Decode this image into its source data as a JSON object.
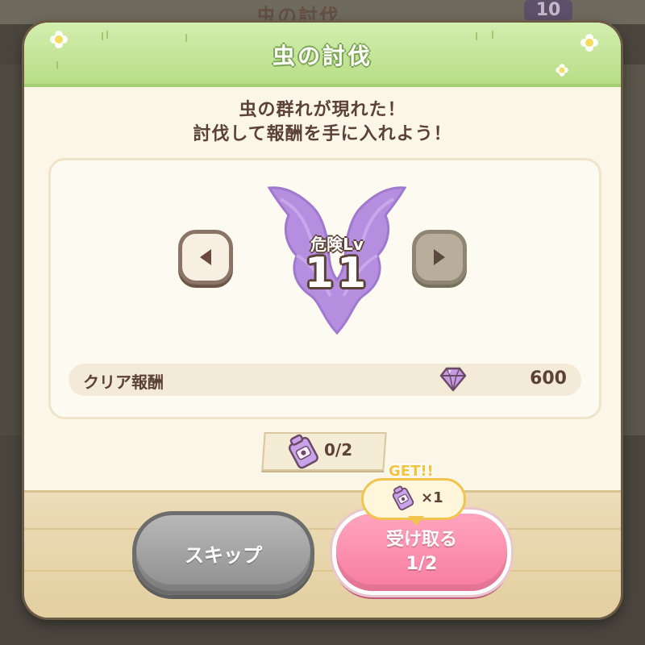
{
  "background": {
    "title": "虫の討伐",
    "count": "10"
  },
  "modal": {
    "title": "虫の討伐",
    "message_line1": "虫の群れが現れた！",
    "message_line2": "討伐して報酬を手に入れよう！"
  },
  "danger": {
    "label": "危険Lv",
    "level": "11"
  },
  "reward": {
    "label": "クリア報酬",
    "icon": "gem-icon",
    "value": "600"
  },
  "ticket_counter": {
    "icon": "ticket-icon",
    "value": "0/2"
  },
  "get_bubble": {
    "label": "GET!!",
    "icon": "ticket-icon",
    "quantity": "×1"
  },
  "buttons": {
    "skip_label": "スキップ",
    "receive_label": "受け取る",
    "receive_count": "1/2"
  },
  "colors": {
    "header_green": "#b7de87",
    "emblem_purple": "#b58ee0",
    "receive_pink": "#f77ca0",
    "skip_gray": "#8f8f8f",
    "text_brown": "#5b4136"
  }
}
